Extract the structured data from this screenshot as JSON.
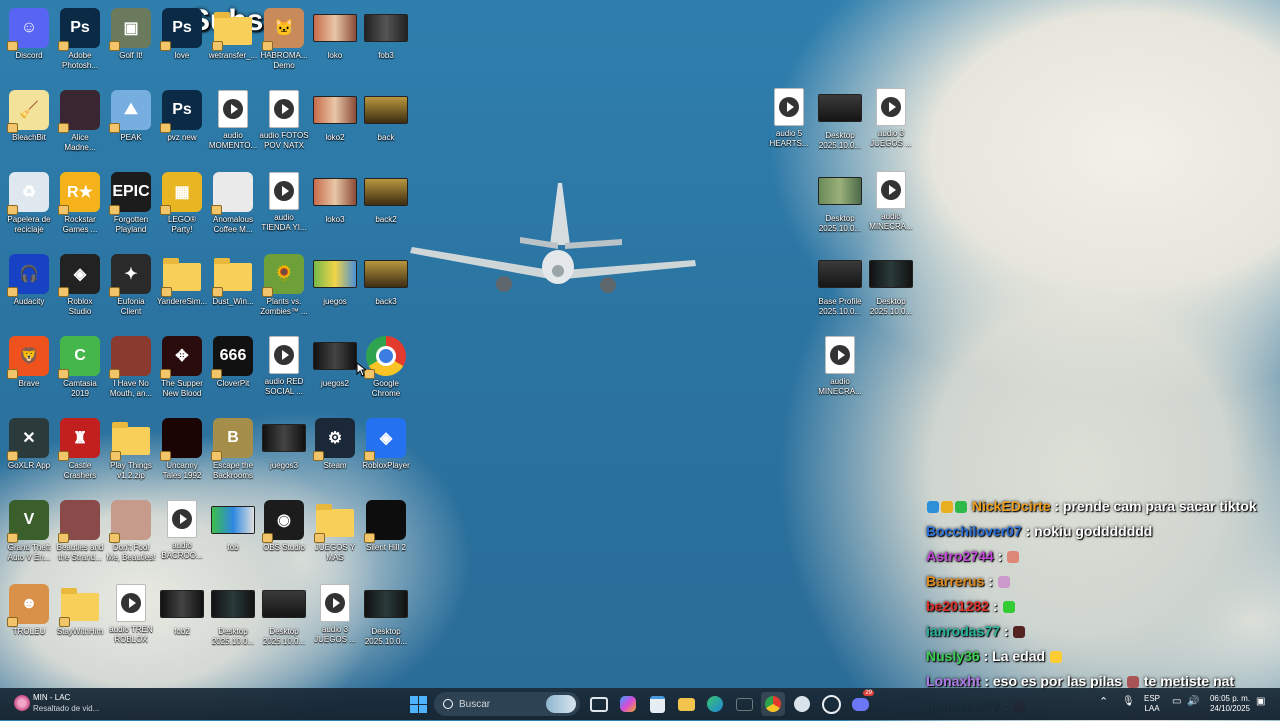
{
  "overlay": {
    "subs_label": "Subs:"
  },
  "desktop_icons": [
    {
      "id": "discord",
      "label": "Discord",
      "color": "#5865f2",
      "text": "☺"
    },
    {
      "id": "photoshop",
      "label": "Adobe\nPhotosh...",
      "color": "#0a2a46",
      "text": "Ps"
    },
    {
      "id": "golf",
      "label": "Golf It!",
      "color": "#6b7a5d",
      "text": "▣"
    },
    {
      "id": "love",
      "label": "love",
      "color": "#0a2a46",
      "text": "Ps"
    },
    {
      "id": "wetransfer",
      "label": "wetransfer_...",
      "color": "folder",
      "text": ""
    },
    {
      "id": "haboroma",
      "label": "HABROMA...\nDemo",
      "color": "#c98a5a",
      "text": "🐱"
    },
    {
      "id": "loko",
      "label": "loko",
      "color": "thumb1",
      "text": ""
    },
    {
      "id": "fob3",
      "label": "fob3",
      "color": "thumb2",
      "text": ""
    },
    {
      "id": "bleachbit",
      "label": "BleachBit",
      "color": "#f2e29a",
      "text": "🧹"
    },
    {
      "id": "alice",
      "label": "Alice\nMadne...",
      "color": "#3a2630",
      "text": ""
    },
    {
      "id": "peak",
      "label": "PEAK",
      "color": "#77aee0",
      "text": "⛰"
    },
    {
      "id": "pvznew",
      "label": "pvz new",
      "color": "#0a2a46",
      "text": "Ps"
    },
    {
      "id": "audio_momento",
      "label": "audio\nMOMENTO...",
      "color": "play",
      "text": ""
    },
    {
      "id": "audio_fotos",
      "label": "audio FOTOS\nPOV NATX",
      "color": "play",
      "text": ""
    },
    {
      "id": "loko2",
      "label": "loko2",
      "color": "thumb1",
      "text": ""
    },
    {
      "id": "back",
      "label": "back",
      "color": "thumb3",
      "text": ""
    },
    {
      "id": "recycle",
      "label": "Papelera de\nreciclaje",
      "color": "#dfe8ef",
      "text": "♻"
    },
    {
      "id": "rockstar",
      "label": "Rockstar\nGames ...",
      "color": "#f5b21a",
      "text": "R★"
    },
    {
      "id": "epic",
      "label": "Forgotten\nPlayland",
      "color": "#1c1c1c",
      "text": "EPIC"
    },
    {
      "id": "lego",
      "label": "LEGO®\nParty!",
      "color": "#e8b623",
      "text": "▦"
    },
    {
      "id": "anomalous",
      "label": "Anomalous\nCoffee M...",
      "color": "#eaeaea",
      "text": ""
    },
    {
      "id": "audio_tienda",
      "label": "audio\nTIENDA YI...",
      "color": "play",
      "text": ""
    },
    {
      "id": "loko3",
      "label": "loko3",
      "color": "thumb1",
      "text": ""
    },
    {
      "id": "back2",
      "label": "back2",
      "color": "thumb3",
      "text": ""
    },
    {
      "id": "audacity",
      "label": "Audacity",
      "color": "#1742c4",
      "text": "🎧"
    },
    {
      "id": "roblox_studio",
      "label": "Roblox\nStudio",
      "color": "#222",
      "text": "◈"
    },
    {
      "id": "eufonia",
      "label": "Eufonia\nClient",
      "color": "#2a2a2a",
      "text": "✦"
    },
    {
      "id": "yanderesim",
      "label": "YandereSim...",
      "color": "folder",
      "text": ""
    },
    {
      "id": "dustwin",
      "label": "Dust_Win...",
      "color": "folder",
      "text": ""
    },
    {
      "id": "pvz",
      "label": "Plants vs.\nZombies™ ...",
      "color": "#6ea03a",
      "text": "🌻"
    },
    {
      "id": "juegos",
      "label": "juegos",
      "color": "thumb4",
      "text": ""
    },
    {
      "id": "back3",
      "label": "back3",
      "color": "thumb3",
      "text": ""
    },
    {
      "id": "brave",
      "label": "Brave",
      "color": "#f0521e",
      "text": "🦁"
    },
    {
      "id": "camtasia",
      "label": "Camtasia\n2019",
      "color": "#45b649",
      "text": "C"
    },
    {
      "id": "ihavenomouth",
      "label": "I Have No\nMouth, an...",
      "color": "#8a3a2e",
      "text": ""
    },
    {
      "id": "supper",
      "label": "The Supper\nNew Blood",
      "color": "#2a0c0c",
      "text": "✥"
    },
    {
      "id": "cloverpit",
      "label": "CloverPit",
      "color": "#111",
      "text": "666"
    },
    {
      "id": "audio_red",
      "label": "audio RED\nSOCIAL ...",
      "color": "play",
      "text": ""
    },
    {
      "id": "juegos2",
      "label": "juegos2",
      "color": "thumb5",
      "text": ""
    },
    {
      "id": "chrome",
      "label": "Google\nChrome",
      "color": "chrome",
      "text": ""
    },
    {
      "id": "goxlr",
      "label": "GoXLR App",
      "color": "#2b3b3b",
      "text": "✕"
    },
    {
      "id": "castle",
      "label": "Castle\nCrashers",
      "color": "#c21f1f",
      "text": "♜"
    },
    {
      "id": "playthings",
      "label": "Play Things\nv1.2.zip",
      "color": "folder",
      "text": ""
    },
    {
      "id": "uncanny",
      "label": "Uncanny\nTales 1992",
      "color": "#1a0404",
      "text": ""
    },
    {
      "id": "escape",
      "label": "Escape the\nBackrooms",
      "color": "#a58d4a",
      "text": "B"
    },
    {
      "id": "juegos3",
      "label": "juegos3",
      "color": "thumb5",
      "text": ""
    },
    {
      "id": "steam",
      "label": "Steam",
      "color": "#1b2838",
      "text": "⚙"
    },
    {
      "id": "robloxplayer",
      "label": "RobloxPlayer",
      "color": "#2472f2",
      "text": "◈"
    },
    {
      "id": "gta5",
      "label": "Grand Theft\nAuto V En...",
      "color": "#3a5f2a",
      "text": "V"
    },
    {
      "id": "beauties",
      "label": "Beauties and\nthe Strand...",
      "color": "#8a4a4a",
      "text": ""
    },
    {
      "id": "dontfool",
      "label": "Don't Fool\nMe, Beauties!",
      "color": "#c79b8b",
      "text": ""
    },
    {
      "id": "audio_bacroo",
      "label": "audio\nBACROO...",
      "color": "play",
      "text": ""
    },
    {
      "id": "fob",
      "label": "fob",
      "color": "thumb6",
      "text": ""
    },
    {
      "id": "obs",
      "label": "OBS Studio",
      "color": "#1c1c1c",
      "text": "◉"
    },
    {
      "id": "juegosymas",
      "label": "JUEGOS Y\nMAS",
      "color": "folder",
      "text": ""
    },
    {
      "id": "silenthill",
      "label": "Silent Hill 2",
      "color": "#0d0d0d",
      "text": ""
    },
    {
      "id": "troleu",
      "label": "TROLEU",
      "color": "#d9914a",
      "text": "☻"
    },
    {
      "id": "staywithhim",
      "label": "StayWithHim",
      "color": "folder",
      "text": ""
    },
    {
      "id": "audio_tren",
      "label": "audio TREN\nROBLOX",
      "color": "play",
      "text": ""
    },
    {
      "id": "fob2",
      "label": "fob2",
      "color": "thumb5",
      "text": ""
    },
    {
      "id": "desktop_a1",
      "label": "Desktop\n2025.10.0...",
      "color": "thumb7",
      "text": ""
    },
    {
      "id": "desktop_a2",
      "label": "Desktop\n2025.10.0...",
      "color": "thumb8",
      "text": ""
    },
    {
      "id": "audio3_a",
      "label": "audio 3\nJUEGOS ...",
      "color": "play",
      "text": ""
    },
    {
      "id": "desktop_b",
      "label": "Desktop\n2025.10.0...",
      "color": "thumb7",
      "text": ""
    },
    {
      "id": "audio5",
      "label": "audio 5\nHEARTS...",
      "color": "play",
      "text": ""
    },
    {
      "id": "desktop_c",
      "label": "Desktop\n2025.10.0...",
      "color": "thumb8",
      "text": ""
    },
    {
      "id": "audio3_b",
      "label": "audio 3\nJUEGOS ...",
      "color": "play",
      "text": ""
    },
    {
      "id": "desktop_d",
      "label": "Desktop\n2025.10.0...",
      "color": "thumb9",
      "text": ""
    },
    {
      "id": "audio_minecra1",
      "label": "audio\nMINECRA...",
      "color": "play",
      "text": ""
    },
    {
      "id": "baseprofile",
      "label": "Base Profile\n2025.10.0...",
      "color": "thumb8",
      "text": ""
    },
    {
      "id": "desktop_e",
      "label": "Desktop\n2025.10.0...",
      "color": "thumb7",
      "text": ""
    },
    {
      "id": "audio_minecra2",
      "label": "audio\nMINECRA...",
      "color": "play",
      "text": ""
    }
  ],
  "chat": [
    {
      "user": "NickEDcirte",
      "user_color": "#f0a020",
      "text": ": prende cam para sacar tiktok",
      "badges": true,
      "emoji": ""
    },
    {
      "user": "Bocchilover07",
      "user_color": "#2b6fd6",
      "text": ": nokiu goddddddd",
      "badges": false,
      "emoji": ""
    },
    {
      "user": "Astro2744",
      "user_color": "#c04ad6",
      "text": ":",
      "badges": false,
      "emoji": "#d87"
    },
    {
      "user": "Barrerus",
      "user_color": "#e08a1e",
      "text": ":",
      "badges": false,
      "emoji": "#c9c"
    },
    {
      "user": "be201282",
      "user_color": "#e0302a",
      "text": ":",
      "badges": false,
      "emoji": "#3c3"
    },
    {
      "user": "ianrodas77",
      "user_color": "#27b59a",
      "text": ":",
      "badges": false,
      "emoji": "#522"
    },
    {
      "user": "Nusly36",
      "user_color": "#3fcf55",
      "text": ": La edad",
      "badges": false,
      "emoji": "#fc3"
    },
    {
      "user": "Lonaxht",
      "user_color": "#b07be8",
      "text": ": eso es por las pilas",
      "badges": false,
      "emoji": "#a55",
      "tail": "te metiste nat"
    },
    {
      "user": "ianrodas77",
      "user_color": "#27b59a",
      "text": ":",
      "badges": false,
      "emoji": "#a33"
    }
  ],
  "taskbar": {
    "notif_title": "MIN - LAC",
    "notif_sub": "Resaltado de vid...",
    "search_placeholder": "Buscar",
    "lang_top": "ESP",
    "lang_bottom": "LAA",
    "time": "06:05 p. m.",
    "date": "24/10/2025",
    "discord_badge": "29"
  }
}
